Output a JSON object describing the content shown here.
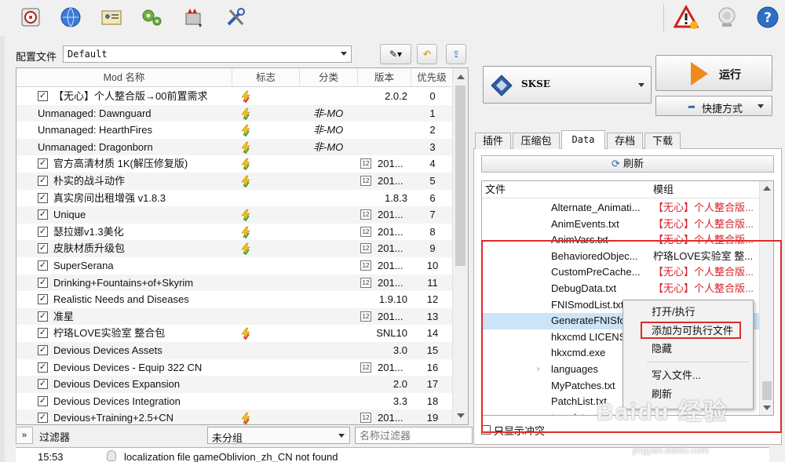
{
  "toolbar": {
    "icons": [
      "install-mod-icon",
      "nexus-globe-icon",
      "profiles-icon",
      "settings-gears-icon",
      "tools-icon",
      "wrench-screwdriver-icon",
      "warning-icon",
      "update-icon",
      "help-icon"
    ]
  },
  "profile": {
    "label": "配置文件",
    "value": "Default"
  },
  "modlist": {
    "headers": {
      "name": "Mod 名称",
      "flags": "标志",
      "category": "分类",
      "version": "版本",
      "priority": "优先级"
    },
    "rows": [
      {
        "name": "【无心】个人整合版→00前置需求",
        "checked": true,
        "flag": "red",
        "category": "",
        "version": "2.0.2",
        "verIcon": false,
        "priority": "0"
      },
      {
        "name": "Unmanaged: Dawnguard",
        "checked": null,
        "flag": "green",
        "category": "非-MO",
        "version": "",
        "verIcon": false,
        "priority": "1"
      },
      {
        "name": "Unmanaged: HearthFires",
        "checked": null,
        "flag": "green",
        "category": "非-MO",
        "version": "",
        "verIcon": false,
        "priority": "2"
      },
      {
        "name": "Unmanaged: Dragonborn",
        "checked": null,
        "flag": "green",
        "category": "非-MO",
        "version": "",
        "verIcon": false,
        "priority": "3"
      },
      {
        "name": "官方高清材质 1K(解压修复版)",
        "checked": true,
        "flag": "green",
        "category": "",
        "version": "201...",
        "verIcon": true,
        "priority": "4"
      },
      {
        "name": "朴实的战斗动作",
        "checked": true,
        "flag": "green",
        "category": "",
        "version": "201...",
        "verIcon": true,
        "priority": "5"
      },
      {
        "name": "真实房间出租增强 v1.8.3",
        "checked": true,
        "flag": "",
        "category": "",
        "version": "1.8.3",
        "verIcon": false,
        "priority": "6"
      },
      {
        "name": "Unique",
        "checked": true,
        "flag": "green",
        "category": "",
        "version": "201...",
        "verIcon": true,
        "priority": "7"
      },
      {
        "name": "瑟拉娜v1.3美化",
        "checked": true,
        "flag": "green",
        "category": "",
        "version": "201...",
        "verIcon": true,
        "priority": "8"
      },
      {
        "name": "皮肤材质升级包",
        "checked": true,
        "flag": "green",
        "category": "",
        "version": "201...",
        "verIcon": true,
        "priority": "9"
      },
      {
        "name": "SuperSerana",
        "checked": true,
        "flag": "",
        "category": "",
        "version": "201...",
        "verIcon": true,
        "priority": "10"
      },
      {
        "name": "Drinking+Fountains+of+Skyrim",
        "checked": true,
        "flag": "",
        "category": "",
        "version": "201...",
        "verIcon": true,
        "priority": "11"
      },
      {
        "name": "Realistic Needs and Diseases",
        "checked": true,
        "flag": "",
        "category": "",
        "version": "1.9.10",
        "verIcon": false,
        "priority": "12"
      },
      {
        "name": "准星",
        "checked": true,
        "flag": "",
        "category": "",
        "version": "201...",
        "verIcon": true,
        "priority": "13"
      },
      {
        "name": "柠珞LOVE实验室 整合包",
        "checked": true,
        "flag": "red",
        "category": "",
        "version": "SNL10",
        "verIcon": false,
        "priority": "14"
      },
      {
        "name": "Devious Devices Assets",
        "checked": true,
        "flag": "",
        "category": "",
        "version": "3.0",
        "verIcon": false,
        "priority": "15"
      },
      {
        "name": "Devious Devices - Equip 322 CN",
        "checked": true,
        "flag": "",
        "category": "",
        "version": "201...",
        "verIcon": true,
        "priority": "16"
      },
      {
        "name": "Devious Devices Expansion",
        "checked": true,
        "flag": "",
        "category": "",
        "version": "2.0",
        "verIcon": false,
        "priority": "17"
      },
      {
        "name": "Devious Devices Integration",
        "checked": true,
        "flag": "",
        "category": "",
        "version": "3.3",
        "verIcon": false,
        "priority": "18"
      },
      {
        "name": "Devious+Training+2.5+CN",
        "checked": true,
        "flag": "red",
        "category": "",
        "version": "201...",
        "verIcon": true,
        "priority": "19"
      }
    ]
  },
  "filter": {
    "toggle": "»",
    "label": "过滤器",
    "group_value": "未分组",
    "name_placeholder": "名称过滤器"
  },
  "log": {
    "time": "15:53",
    "message": "localization file gameOblivion_zh_CN not found"
  },
  "executable": {
    "name": "SKSE",
    "run_label": "运行",
    "shortcut_label": "快捷方式"
  },
  "tabs": [
    "插件",
    "压缩包",
    "Data",
    "存档",
    "下载"
  ],
  "active_tab": "Data",
  "data_tab": {
    "refresh_label": "刷新",
    "headers": {
      "file": "文件",
      "mod": "模组"
    },
    "rows": [
      {
        "file": "Alternate_Animati...",
        "mod": "【无心】个人整合版...",
        "red": true,
        "expander": false,
        "selected": false
      },
      {
        "file": "AnimEvents.txt",
        "mod": "【无心】个人整合版...",
        "red": true,
        "expander": false,
        "selected": false
      },
      {
        "file": "AnimVars.txt",
        "mod": "【无心】个人整合版...",
        "red": true,
        "expander": false,
        "selected": false
      },
      {
        "file": "BehavioredObjec...",
        "mod": "柠珞LOVE实验室 整...",
        "red": false,
        "expander": false,
        "selected": false
      },
      {
        "file": "CustomPreCache...",
        "mod": "【无心】个人整合版...",
        "red": true,
        "expander": false,
        "selected": false
      },
      {
        "file": "DebugData.txt",
        "mod": "【无心】个人整合版...",
        "red": true,
        "expander": false,
        "selected": false
      },
      {
        "file": "FNISmodList.txt",
        "mod": "",
        "red": false,
        "expander": false,
        "selected": false
      },
      {
        "file": "GenerateFNISfor",
        "mod": "",
        "red": false,
        "expander": false,
        "selected": true
      },
      {
        "file": "hkxcmd LICENSE",
        "mod": "",
        "red": false,
        "expander": false,
        "selected": false
      },
      {
        "file": "hkxcmd.exe",
        "mod": "",
        "red": false,
        "expander": false,
        "selected": false
      },
      {
        "file": "languages",
        "mod": "",
        "red": false,
        "expander": true,
        "selected": false
      },
      {
        "file": "MyPatches.txt",
        "mod": "",
        "red": false,
        "expander": false,
        "selected": false
      },
      {
        "file": "PatchList.txt",
        "mod": "",
        "red": false,
        "expander": false,
        "selected": false
      },
      {
        "file": "templates",
        "mod": "",
        "red": false,
        "expander": true,
        "selected": false
      }
    ],
    "conflict_only_label": "只显示冲突"
  },
  "context_menu": {
    "items": [
      "打开/执行",
      "添加为可执行文件",
      "隐藏",
      "写入文件...",
      "刷新"
    ],
    "highlighted": "添加为可执行文件"
  },
  "watermark": {
    "text": "Baidu 经验",
    "url": "jingyan.baidu.com"
  },
  "colors": {
    "accent_red": "#e02a2a",
    "mod_red": "#d8232a",
    "run_orange": "#f08a1c",
    "selection": "#cce4f7"
  }
}
